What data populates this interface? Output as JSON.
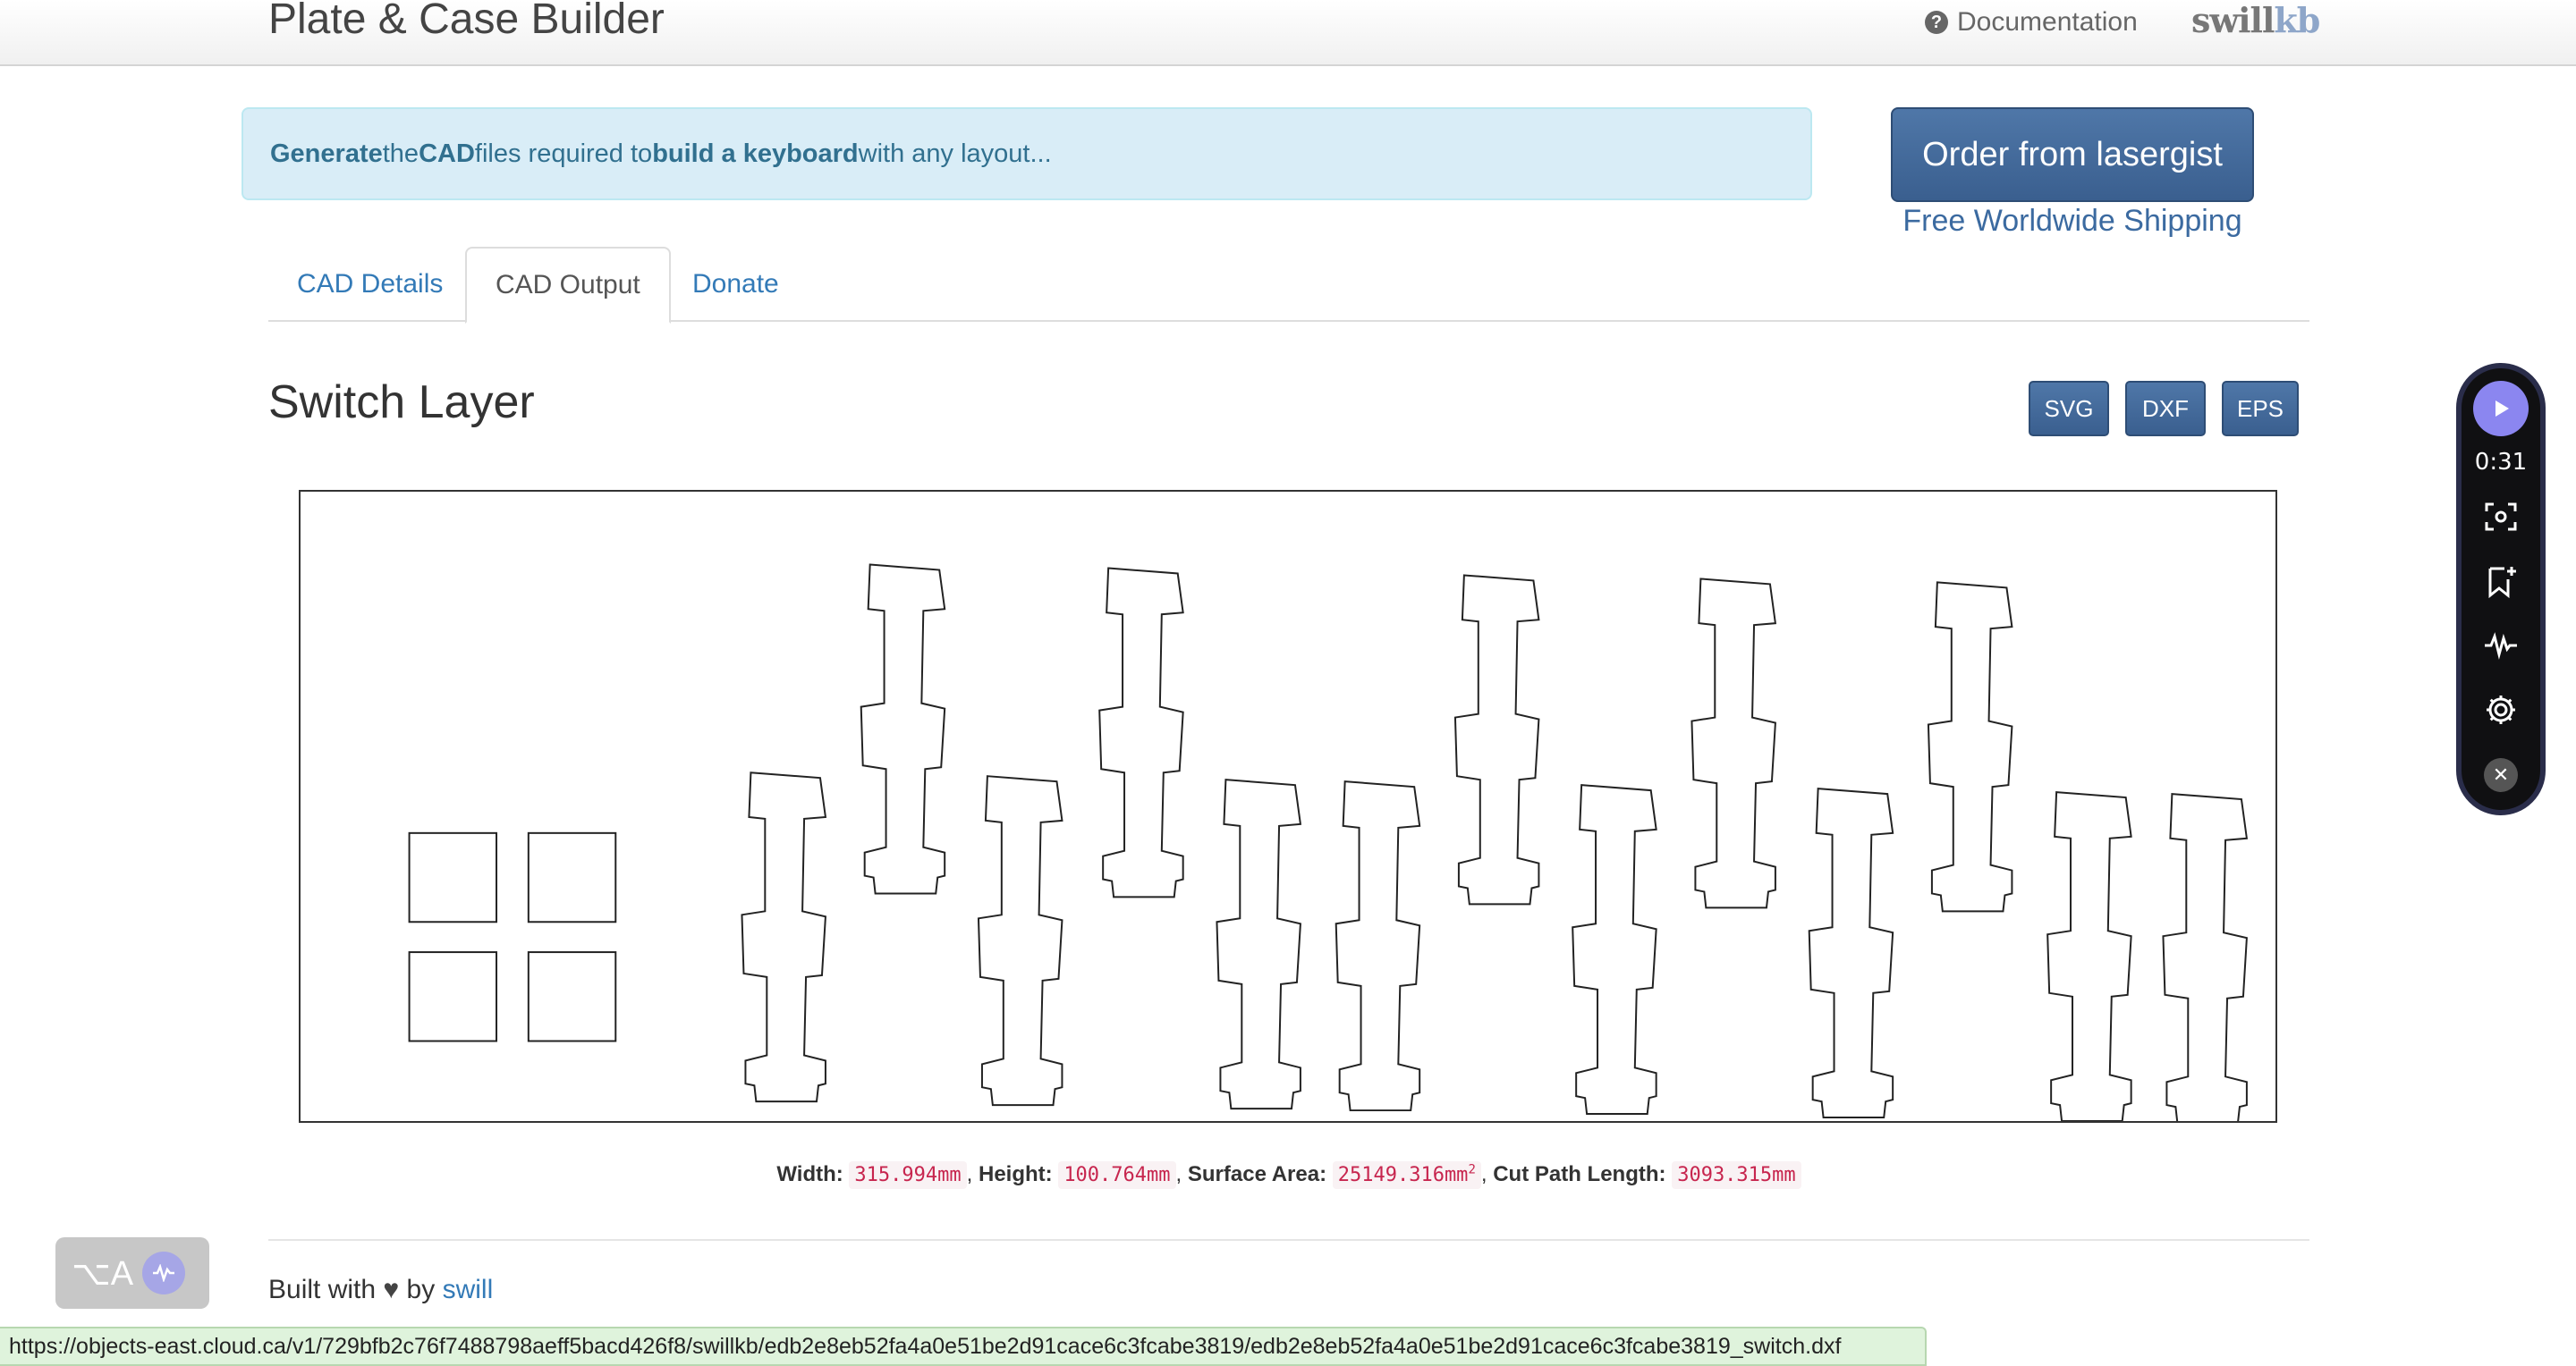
{
  "navbar": {
    "brand": "Plate & Case Builder",
    "documentation_label": "Documentation",
    "logo_main": "swill",
    "logo_accent": "kb"
  },
  "alert": {
    "part1": "Generate",
    "part2": " the ",
    "part3": "CAD",
    "part4": " files required to ",
    "part5": "build a keyboard",
    "part6": " with any layout..."
  },
  "order": {
    "button_label": "Order from lasergist",
    "subtitle": "Free Worldwide Shipping"
  },
  "tabs": [
    {
      "label": "CAD Details",
      "active": false
    },
    {
      "label": "CAD Output",
      "active": true
    },
    {
      "label": "Donate",
      "active": false
    }
  ],
  "layer": {
    "title": "Switch Layer",
    "downloads": [
      "SVG",
      "DXF",
      "EPS"
    ]
  },
  "stats": {
    "width_label": "Width:",
    "width_value": "315.994mm",
    "height_label": "Height:",
    "height_value": "100.764mm",
    "area_label": "Surface Area:",
    "area_value": "25149.316mm",
    "area_unit_sup": "2",
    "cut_label": "Cut Path Length:",
    "cut_value": "3093.315mm"
  },
  "footer": {
    "built_with": "Built with",
    "by": "by",
    "author": "swill"
  },
  "statusbar": {
    "url": "https://objects-east.cloud.ca/v1/729bfb2c76f7488798aeff5bacd426f8/swillkb/edb2e8eb52fa4a0e51be2d91cace6c3fcabe3819/edb2e8eb52fa4a0e51be2d91cace6c3fcabe3819_switch.dxf"
  },
  "float_pill": {
    "text": "⌥A"
  },
  "recorder": {
    "time": "0:31"
  },
  "colors": {
    "primary_button": "#3a5f8f",
    "link": "#337ab7",
    "alert_bg": "#d9edf7",
    "code_text": "#c7254e",
    "recorder_accent": "#8b86f0"
  }
}
